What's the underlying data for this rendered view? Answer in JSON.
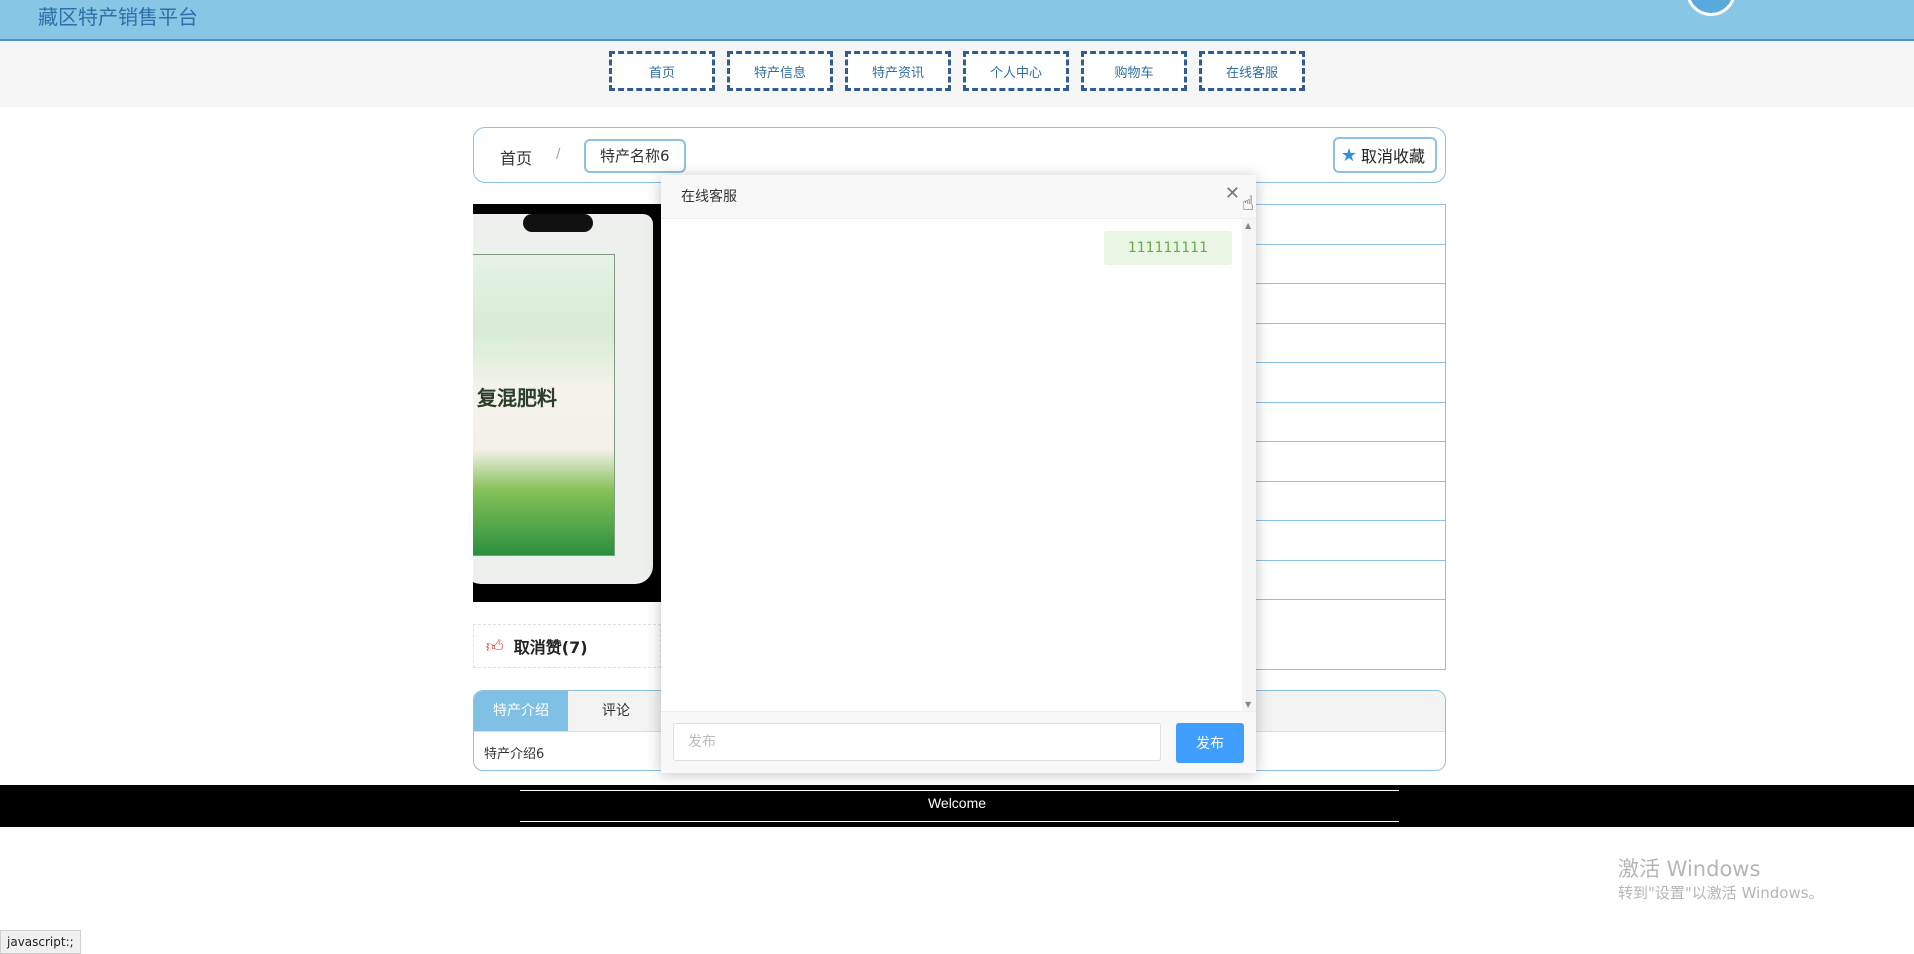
{
  "header": {
    "site_title": "藏区特产销售平台"
  },
  "nav": {
    "items": [
      "首页",
      "特产信息",
      "特产资讯",
      "个人中心",
      "购物车",
      "在线客服"
    ]
  },
  "breadcrumb": {
    "home": "首页",
    "separator": "/",
    "current": "特产名称6"
  },
  "favorite": {
    "label": "取消收藏",
    "icon": "star-icon"
  },
  "like": {
    "label": "取消赞(7)",
    "icon": "thumbs-up-icon"
  },
  "product_image": {
    "text": "复混肥料"
  },
  "tabs": {
    "items": [
      "特产介绍",
      "评论"
    ],
    "active": "特产介绍",
    "content": "特产介绍6"
  },
  "footer": {
    "text": "Welcome"
  },
  "chat": {
    "title": "在线客服",
    "messages": [
      "111111111"
    ],
    "input_placeholder": "发布",
    "send_label": "发布"
  },
  "watermark": {
    "line1": "激活 Windows",
    "line2": "转到\"设置\"以激活 Windows。"
  },
  "statusbar": {
    "text": "javascript:;"
  },
  "colors": {
    "header_bg": "#88c6e6",
    "accent": "#409eff",
    "tab_active": "#7fc0e4",
    "bubble_bg": "#e9f6e3"
  }
}
